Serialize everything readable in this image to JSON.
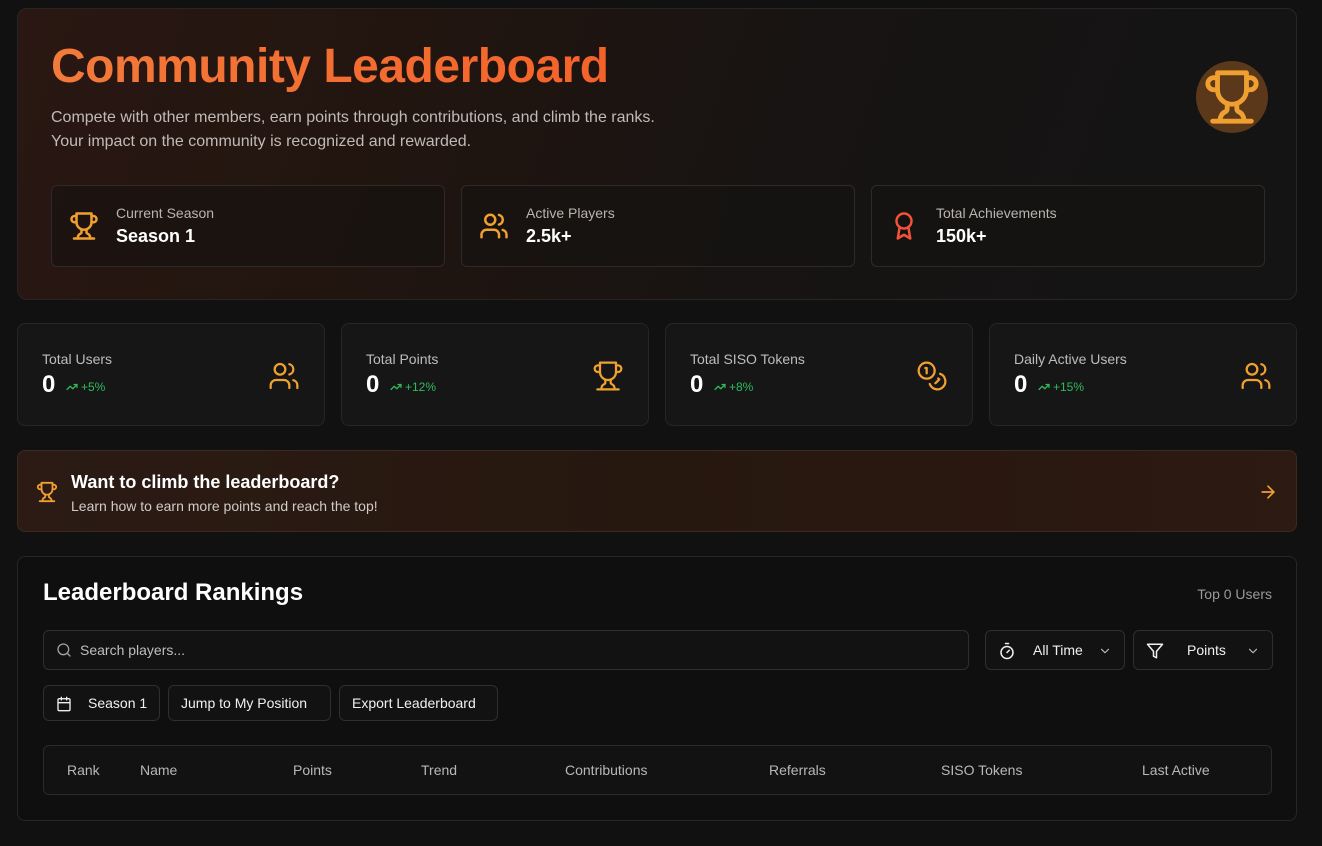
{
  "hero": {
    "title": "Community Leaderboard",
    "description_line1": "Compete with other members, earn points through contributions, and climb the ranks.",
    "description_line2": "Your impact on the community is recognized and rewarded.",
    "cards": [
      {
        "label": "Current Season",
        "value": "Season 1",
        "icon": "trophy-icon"
      },
      {
        "label": "Active Players",
        "value": "2.5k+",
        "icon": "users-icon"
      },
      {
        "label": "Total Achievements",
        "value": "150k+",
        "icon": "award-icon"
      }
    ]
  },
  "stats": [
    {
      "label": "Total Users",
      "value": "0",
      "trend": "+5%",
      "icon": "users-icon"
    },
    {
      "label": "Total Points",
      "value": "0",
      "trend": "+12%",
      "icon": "trophy-icon"
    },
    {
      "label": "Total SISO Tokens",
      "value": "0",
      "trend": "+8%",
      "icon": "coins-icon"
    },
    {
      "label": "Daily Active Users",
      "value": "0",
      "trend": "+15%",
      "icon": "users-icon"
    }
  ],
  "banner": {
    "title": "Want to climb the leaderboard?",
    "subtitle": "Learn how to earn more points and reach the top!"
  },
  "rankings": {
    "title": "Leaderboard Rankings",
    "count": "Top 0 Users",
    "search_placeholder": "Search players...",
    "time_filter": "All Time",
    "sort_filter": "Points",
    "season_button": "Season 1",
    "jump_button": "Jump to My Position",
    "export_button": "Export Leaderboard",
    "columns": [
      "Rank",
      "Name",
      "Points",
      "Trend",
      "Contributions",
      "Referrals",
      "SISO Tokens",
      "Last Active"
    ]
  },
  "colors": {
    "accent": "#f4622a",
    "icon_orange": "#f0a030",
    "trend_green": "#2dbb5d",
    "background": "#111111"
  }
}
